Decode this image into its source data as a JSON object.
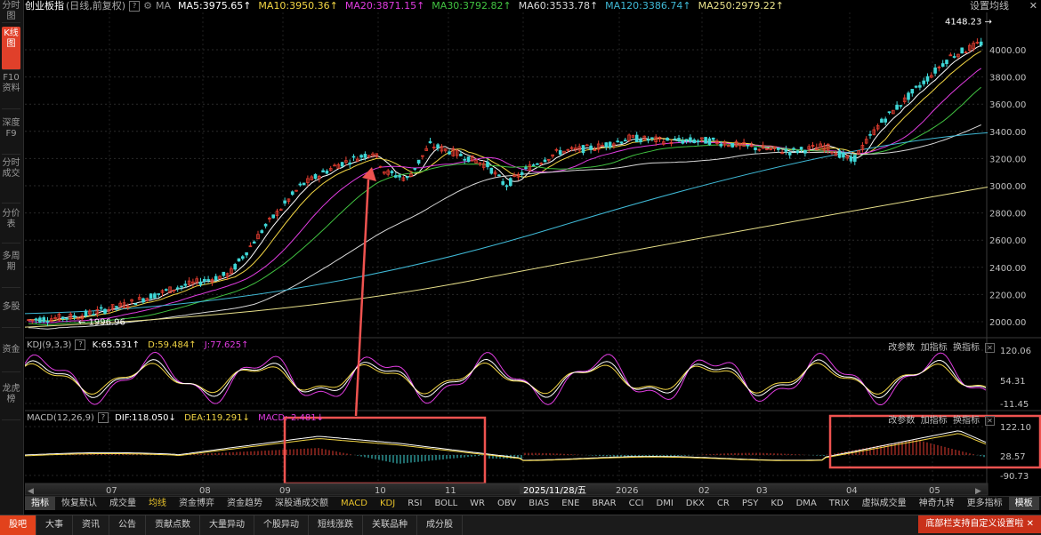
{
  "sidenav": [
    {
      "label": "分时图"
    },
    {
      "label": "K线图"
    },
    {
      "label": "F10资料"
    },
    {
      "label": "深度F9"
    },
    {
      "label": "分时成交"
    },
    {
      "label": "分价表"
    },
    {
      "label": "多周期"
    },
    {
      "label": "多股"
    },
    {
      "label": "资金"
    },
    {
      "label": "龙虎榜"
    }
  ],
  "header": {
    "title": "创业板指",
    "period": "(日线,前复权)",
    "help": "?",
    "settings_icon": "gear-icon",
    "ma_label": "MA",
    "ma": [
      {
        "label": "MA5:3975.65",
        "arrow": "↑",
        "color": "#ffffff"
      },
      {
        "label": "MA10:3950.36",
        "arrow": "↑",
        "color": "#f2d544"
      },
      {
        "label": "MA20:3871.15",
        "arrow": "↑",
        "color": "#e03ce0"
      },
      {
        "label": "MA30:3792.82",
        "arrow": "↑",
        "color": "#41c241"
      },
      {
        "label": "MA60:3533.78",
        "arrow": "↑",
        "color": "#d8d8d8"
      },
      {
        "label": "MA120:3386.74",
        "arrow": "↑",
        "color": "#3fb9d6"
      },
      {
        "label": "MA250:2979.22",
        "arrow": "↑",
        "color": "#e8e08a"
      }
    ],
    "set_ma": "设置均线",
    "close_icon": "close-icon"
  },
  "main_chart": {
    "max_label": "4148.23",
    "min_label": "1996.96",
    "yticks": [
      "4000.00",
      "3800.00",
      "3600.00",
      "3400.00",
      "3200.00",
      "3000.00",
      "2800.00",
      "2600.00",
      "2400.00",
      "2200.00",
      "2000.00"
    ]
  },
  "kdj": {
    "name": "KDJ(9,3,3)",
    "k": "K:65.531",
    "k_arrow": "↑",
    "d": "D:59.484",
    "d_arrow": "↑",
    "j": "J:77.625",
    "j_arrow": "↑",
    "yticks": [
      "120.06",
      "54.31",
      "-11.45"
    ],
    "btn_params": "改参数",
    "btn_add": "加指标",
    "btn_switch": "换指标"
  },
  "macd": {
    "name": "MACD(12,26,9)",
    "dif": "DIF:118.050",
    "dif_arrow": "↓",
    "dea": "DEA:119.291",
    "dea_arrow": "↓",
    "macd": "MACD:-2.481",
    "macd_arrow": "↓",
    "yticks": [
      "122.10",
      "28.57",
      "-90.73"
    ],
    "btn_params": "改参数",
    "btn_add": "加指标",
    "btn_switch": "换指标"
  },
  "xaxis": {
    "labels": [
      "07",
      "08",
      "09",
      "10",
      "11",
      "2025/11/28/五",
      "2026",
      "02",
      "03",
      "04",
      "05"
    ]
  },
  "indicators": {
    "items": [
      "指标",
      "恢复默认",
      "成交量",
      "均线",
      "资金博弈",
      "资金趋势",
      "深股通成交额",
      "MACD",
      "KDJ",
      "RSI",
      "BOLL",
      "WR",
      "OBV",
      "BIAS",
      "ENE",
      "BRAR",
      "CCI",
      "DMI",
      "DKX",
      "CR",
      "PSY",
      "KD",
      "DMA",
      "TRIX",
      "虚拟成交量",
      "神奇九转",
      "更多指标",
      "模板"
    ],
    "active": [
      "指标",
      "模板"
    ],
    "highlight": [
      "均线",
      "MACD",
      "KDJ"
    ]
  },
  "bottom_tabs": [
    "股吧",
    "大事",
    "资讯",
    "公告",
    "贡献点数",
    "大量异动",
    "个股异动",
    "短线涨跌",
    "关联品种",
    "成分股"
  ],
  "bottom_hint": "底部栏支持自定义设置啦",
  "colors": {
    "up": "#e23d2f",
    "down": "#3fd7d7",
    "annotation": "#ef5350"
  }
}
